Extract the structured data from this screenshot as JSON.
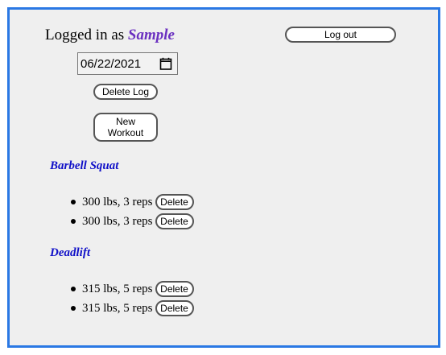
{
  "header": {
    "logged_in_prefix": "Logged in as ",
    "username": "Sample",
    "logout_label": "Log out"
  },
  "log": {
    "date_value": "06/22/2021",
    "calendar_icon": "calendar-icon",
    "delete_log_label": "Delete Log",
    "new_workout_label": "New\nWorkout"
  },
  "exercises": [
    {
      "name": "Barbell Squat",
      "sets": [
        {
          "text": "300 lbs, 3 reps",
          "delete_label": "Delete"
        },
        {
          "text": "300 lbs, 3 reps",
          "delete_label": "Delete"
        }
      ]
    },
    {
      "name": "Deadlift",
      "sets": [
        {
          "text": "315 lbs, 5 reps",
          "delete_label": "Delete"
        },
        {
          "text": "315 lbs, 5 reps",
          "delete_label": "Delete"
        }
      ]
    }
  ],
  "colors": {
    "frame_border": "#2a78e4",
    "username": "#6a2fc0",
    "exercise_title": "#1010c8"
  }
}
